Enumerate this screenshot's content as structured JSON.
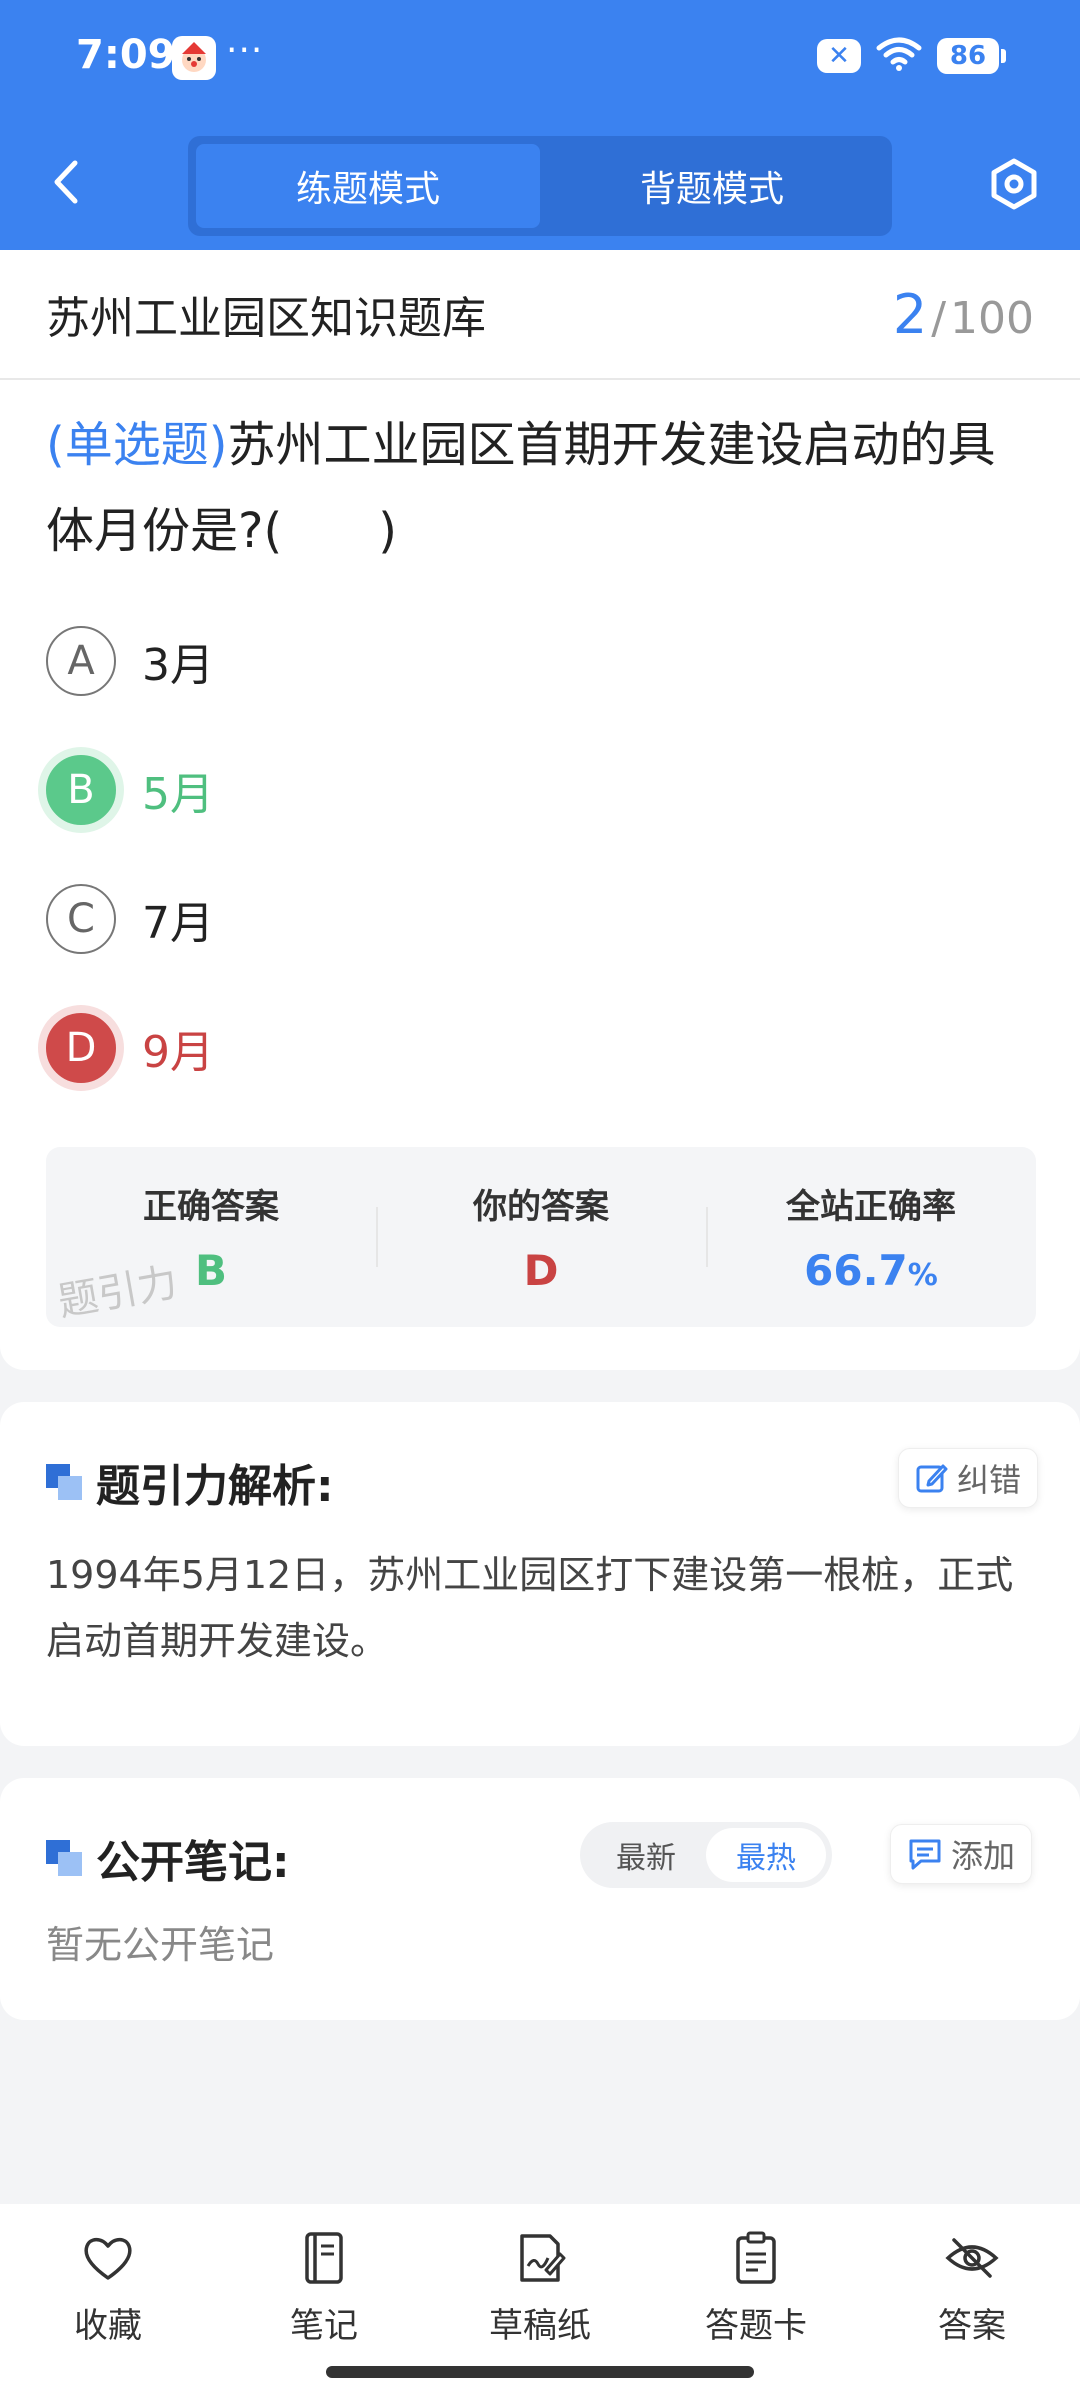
{
  "status_bar": {
    "time": "7:09",
    "dots": "···",
    "battery": "86"
  },
  "nav": {
    "tabs": [
      {
        "label": "练题模式",
        "active": true
      },
      {
        "label": "背题模式",
        "active": false
      }
    ]
  },
  "bank": {
    "title": "苏州工业园区知识题库",
    "current": "2",
    "separator": "/",
    "total": "100"
  },
  "question": {
    "type": "(单选题)",
    "text": "苏州工业园区首期开发建设启动的具体月份是?(　　)"
  },
  "options": [
    {
      "letter": "A",
      "text": "3月",
      "state": "normal"
    },
    {
      "letter": "B",
      "text": "5月",
      "state": "correct"
    },
    {
      "letter": "C",
      "text": "7月",
      "state": "normal"
    },
    {
      "letter": "D",
      "text": "9月",
      "state": "wrong"
    }
  ],
  "answer_panel": {
    "correct_label": "正确答案",
    "correct_value": "B",
    "yours_label": "你的答案",
    "yours_value": "D",
    "rate_label": "全站正确率",
    "rate_value": "66.7",
    "rate_unit": "%",
    "watermark": "题引力"
  },
  "analysis": {
    "title": "题引力解析:",
    "correct_button": "纠错",
    "text": "1994年5月12日，苏州工业园区打下建设第一根桩，正式启动首期开发建设。"
  },
  "notes": {
    "title": "公开笔记:",
    "sort_options": [
      {
        "label": "最新",
        "active": false
      },
      {
        "label": "最热",
        "active": true
      }
    ],
    "add_button": "添加",
    "empty_text": "暂无公开笔记"
  },
  "toolbar": {
    "items": [
      {
        "label": "收藏",
        "icon": "heart-icon"
      },
      {
        "label": "笔记",
        "icon": "notebook-icon"
      },
      {
        "label": "草稿纸",
        "icon": "draft-paper-icon"
      },
      {
        "label": "答题卡",
        "icon": "answer-card-icon"
      },
      {
        "label": "答案",
        "icon": "eye-off-icon"
      }
    ]
  },
  "colors": {
    "primary": "#3b82f0",
    "correct": "#5bc98b",
    "wrong": "#cf4a4a"
  }
}
